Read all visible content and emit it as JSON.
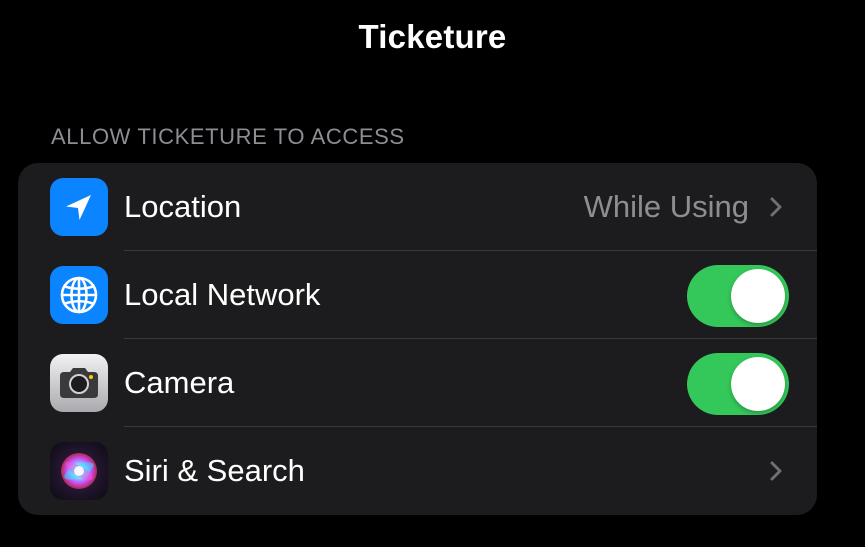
{
  "nav": {
    "title": "Ticketure"
  },
  "section": {
    "header": "ALLOW TICKETURE TO ACCESS"
  },
  "rows": [
    {
      "label": "Location",
      "value": "While Using",
      "icon": "location-arrow-icon",
      "accessory": "chevron",
      "icon_color": "#0a84ff"
    },
    {
      "label": "Local Network",
      "icon": "globe-icon",
      "accessory": "toggle",
      "enabled": true,
      "icon_color": "#0a84ff"
    },
    {
      "label": "Camera",
      "icon": "camera-icon",
      "accessory": "toggle",
      "enabled": true,
      "icon_color": "#d1d1d6"
    },
    {
      "label": "Siri & Search",
      "icon": "siri-icon",
      "accessory": "chevron"
    }
  ],
  "colors": {
    "background": "#000000",
    "group_background": "#1c1c1e",
    "toggle_on": "#34c759",
    "secondary_text": "#8d8d93"
  }
}
